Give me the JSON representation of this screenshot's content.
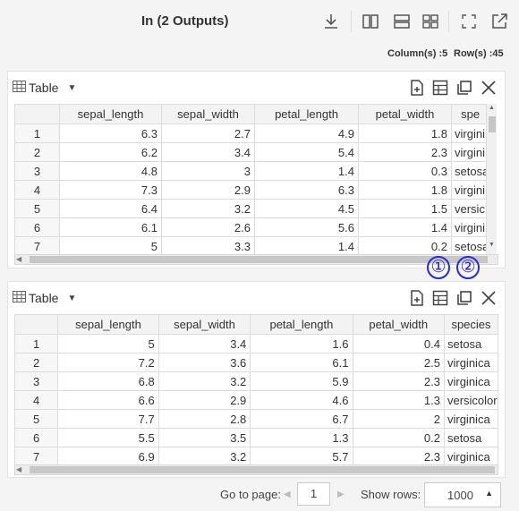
{
  "header": {
    "title": "In (2 Outputs)",
    "columns_label": "Column(s) :5",
    "rows_label": "Row(s) :45"
  },
  "panels": [
    {
      "title": "Table",
      "columns": [
        "",
        "sepal_length",
        "sepal_width",
        "petal_length",
        "petal_width",
        "spe"
      ],
      "rows": [
        [
          "1",
          "6.3",
          "2.7",
          "4.9",
          "1.8",
          "virgini"
        ],
        [
          "2",
          "6.2",
          "3.4",
          "5.4",
          "2.3",
          "virgini"
        ],
        [
          "3",
          "4.8",
          "3",
          "1.4",
          "0.3",
          "setosa"
        ],
        [
          "4",
          "7.3",
          "2.9",
          "6.3",
          "1.8",
          "virgini"
        ],
        [
          "5",
          "6.4",
          "3.2",
          "4.5",
          "1.5",
          "versic"
        ],
        [
          "6",
          "6.1",
          "2.6",
          "5.6",
          "1.4",
          "virgini"
        ],
        [
          "7",
          "5",
          "3.3",
          "1.4",
          "0.2",
          "setosa"
        ]
      ]
    },
    {
      "title": "Table",
      "columns": [
        "",
        "sepal_length",
        "sepal_width",
        "petal_length",
        "petal_width",
        "species"
      ],
      "rows": [
        [
          "1",
          "5",
          "3.4",
          "1.6",
          "0.4",
          "setosa"
        ],
        [
          "2",
          "7.2",
          "3.6",
          "6.1",
          "2.5",
          "virginica"
        ],
        [
          "3",
          "6.8",
          "3.2",
          "5.9",
          "2.3",
          "virginica"
        ],
        [
          "4",
          "6.6",
          "2.9",
          "4.6",
          "1.3",
          "versicolor"
        ],
        [
          "5",
          "7.7",
          "2.8",
          "6.7",
          "2",
          "virginica"
        ],
        [
          "6",
          "5.5",
          "3.5",
          "1.3",
          "0.2",
          "setosa"
        ],
        [
          "7",
          "6.9",
          "3.2",
          "5.7",
          "2.3",
          "virginica"
        ]
      ]
    }
  ],
  "annotations": [
    "①",
    "②"
  ],
  "pager": {
    "go_to_label": "Go to page:",
    "page_value": "1",
    "show_rows_label": "Show rows:",
    "rows_value": "1000"
  },
  "colors": {
    "accent_annotation": "#2b2bd0",
    "header_bg": "#f3f3f3",
    "border": "#dcdcdc"
  },
  "icons": [
    "download-icon",
    "split-vertical-icon",
    "split-horizontal-icon",
    "grid-icon",
    "expand-icon",
    "open-external-icon",
    "table-icon",
    "new-file-icon",
    "table-settings-icon",
    "copy-icon",
    "close-icon"
  ]
}
